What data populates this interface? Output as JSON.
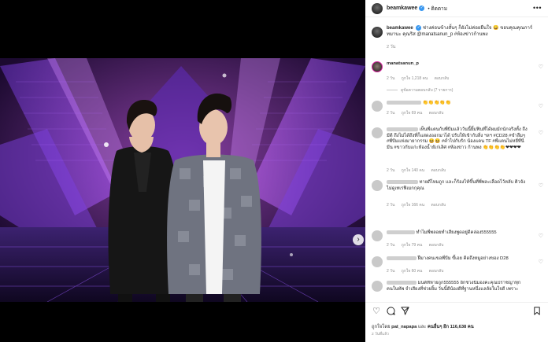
{
  "post": {
    "username": "beamkawee",
    "follow_label": "• ติดตาม",
    "more_label": "•••",
    "caption": {
      "text": "ช่างค่อนข้างสั้นๆ ก็ยังไม่ค่อยยืนใจ 😄 ขอบคุณคุณการ์ทมานะ คุณริส @manatsanun_p #ห้องข่าวก้านพง",
      "time": "2 วัน"
    },
    "photo_next": "›",
    "comments": [
      {
        "user": "manatsanun_p",
        "text": "",
        "time": "2 วัน",
        "likes": "ถูกใจ 1,218 คน",
        "reply": "ตอบกลับ",
        "replies": "ดูข้อความตอบกลับ (7 รายการ)"
      },
      {
        "user": "",
        "text": "👏👏👏👏👏",
        "time": "2 วัน",
        "likes": "ถูกใจ 69 คน",
        "reply": "ตอบกลับ"
      },
      {
        "user": "",
        "text": "เห็นพี่แตนกับพี่บีมแล้ววันนี้ยิ้มฟินที่ได้ผมมักนักจริงทั้ง ถึงมีดี ถึงไม่ได้ถึงที่ก็แสดงออกมาได้ ปรับให้เข้ากับสิ่ง ฯลฯ #CD28 #ขำลืมๆ #พี่บีมแห่งมายากรรม 😆😆 #ค่ำไปกับรัก น้องแคน TF #พี่แตนไม่หยี่ที่นี่มีน #ขาวกับแก่ะห้องน้ำยัเก่เลิศ #ห้องข่าว ก้านพง 👏👏👏👏❤❤❤❤",
        "time": "2 วัน",
        "likes": "ถูกใจ 140 คน",
        "reply": "ตอบกลับ"
      },
      {
        "user": "",
        "text": "ทายดีไหมถูก และก็ร้องไห้ขึ้นที่พี่พละเลือดไว้หลับ ติวจังไม่ดูเทเรฟิเมกกุคุณ",
        "time": "2 วัน",
        "likes": "ถูกใจ 166 คน",
        "reply": "ตอบกลับ"
      },
      {
        "user": "",
        "text": "ทำไมพี่พลอยทำเสียงพูดอยู่ดีคล่อง555555",
        "time": "2 วัน",
        "likes": "ถูกใจ 79 คน",
        "reply": "ตอบกลับ"
      },
      {
        "user": "",
        "text": "ฝืมางคนเขอพี่บีม ขี้เอย คิดถึงหมูอย่างของ D28",
        "time": "2 วัน",
        "likes": "ถูกใจ 60 คน",
        "reply": "ตอบกลับ"
      },
      {
        "user": "",
        "text": "มนต์ที่หายถูก555555 อีกช่วงนี้มองคะคุณปราชญาทุกคนในทัพ จำเสียงที่ช่วยยิ้ม วันนี้ดีน้องดีที่ฐานหนึ่งแลลัยในใจดี เพราะ",
        "time": "",
        "likes": "",
        "reply": ""
      }
    ],
    "liked_by": {
      "prefix": "ถูกใจโดย",
      "user": "pat_napapa",
      "mid": "และ",
      "others": "คนอื่นๆ อีก 116,638 คน"
    },
    "date": "2 วันที่แล้ว"
  },
  "icons": [
    "heart-icon",
    "comment-icon",
    "share-icon",
    "bookmark-icon",
    "verified-badge-icon",
    "more-options-icon"
  ],
  "colors": {
    "link": "#00376b",
    "verified": "#3897f0",
    "muted": "#8e8e8e",
    "text": "#262626"
  }
}
